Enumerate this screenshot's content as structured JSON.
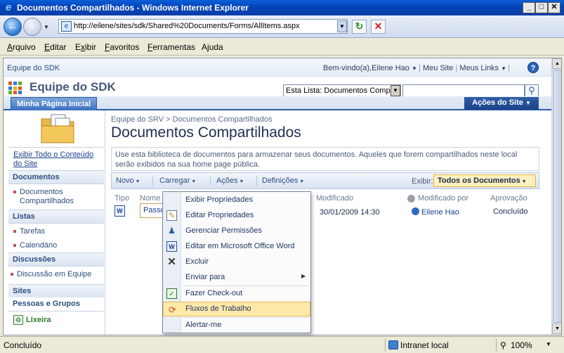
{
  "window": {
    "title": "Documentos Compartilhados - Windows Internet Explorer",
    "controls": [
      "_",
      "□",
      "✕"
    ]
  },
  "address": {
    "url": "http://eilene/sites/sdk/Shared%20Documents/Forms/AllItems.aspx"
  },
  "menubar": {
    "items": [
      "Arquivo",
      "Editar",
      "Exibir",
      "Favoritos",
      "Ferramentas",
      "Ajuda"
    ],
    "accelerators": [
      "A",
      "E",
      "x",
      "F",
      "F",
      "j"
    ]
  },
  "topbar": {
    "site_link": "Equipe do SDK",
    "welcome": "Bem-vindo(a),Eilene Hao",
    "my_site": "Meu Site",
    "my_links": "Meus Links",
    "help": "?"
  },
  "header": {
    "site_title": "Equipe do SDK",
    "search_scope": "Esta Lista: Documentos Compa",
    "search_placeholder": ""
  },
  "tabs": {
    "home": "Minha Página Inicial",
    "site_actions": "Ações do Site"
  },
  "leftnav": {
    "view_all": "Exibir Todo o Conteúdo do Site",
    "sections": [
      {
        "heading": "Documentos",
        "items": [
          "Documentos Compartilhados"
        ]
      },
      {
        "heading": "Listas",
        "items": [
          "Tarefas",
          "Calendário"
        ]
      },
      {
        "heading": "Discussões",
        "items": [
          "Discussão em Equipe"
        ]
      },
      {
        "heading": "Sites",
        "items": []
      },
      {
        "heading": "Pessoas e Grupos",
        "items": []
      }
    ],
    "recycle_bin": "Lixeira"
  },
  "content": {
    "breadcrumb": [
      "Equipe do SRV",
      "Documentos Compartilhados"
    ],
    "breadcrumb_sep": ">",
    "title": "Documentos Compartilhados",
    "description": "Use esta biblioteca de documentos para armazenar seus documentos. Aqueles que forem compartilhados neste local serão exibidos na sua home page pública.",
    "toolbar": {
      "new": "Novo",
      "upload": "Carregar",
      "actions": "Ações",
      "settings": "Definições",
      "view_label": "Exibir:",
      "view_value": "Todos os Documentos"
    },
    "columns": [
      "Tipo",
      "Nome",
      "Modificado",
      "Modificado por",
      "Aprovação"
    ],
    "rows": [
      {
        "name": "Passo",
        "modified": "30/01/2009  14:30",
        "modified_by": "Eilene Hao",
        "approval": "Concluído"
      }
    ]
  },
  "context_menu": {
    "items": [
      {
        "label": "Exibir Propriedades",
        "icon": "none"
      },
      {
        "label": "Editar Propriedades",
        "icon": "edit-properties-icon"
      },
      {
        "label": "Gerenciar Permissões",
        "icon": "permissions-icon"
      },
      {
        "label": "Editar em Microsoft Office Word",
        "icon": "word-icon"
      },
      {
        "label": "Excluir",
        "icon": "delete-icon"
      },
      {
        "label": "Enviar para",
        "icon": "none",
        "submenu": true
      },
      {
        "label": "Fazer Check-out",
        "icon": "checkout-icon"
      },
      {
        "label": "Fluxos de Trabalho",
        "icon": "workflow-icon",
        "highlighted": true
      },
      {
        "label": "Alertar-me",
        "icon": "none"
      }
    ]
  },
  "statusbar": {
    "status": "Concluído",
    "zone": "Intranet local",
    "zoom": "100%"
  },
  "colors": {
    "title_bar": "#0543b8",
    "sp_blue": "#2a5aa8",
    "highlight": "#ffe9a8",
    "view_select": "#fff0c0"
  }
}
